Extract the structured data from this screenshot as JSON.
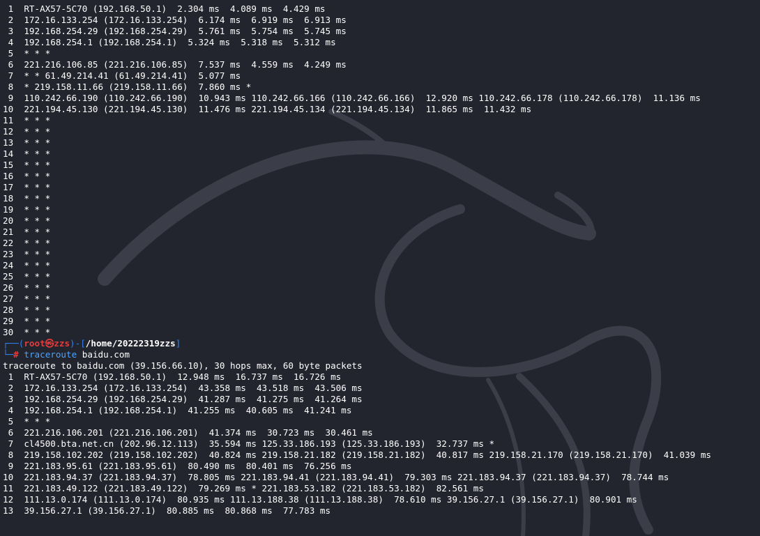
{
  "theme": {
    "background": "#23252e",
    "text": "#ffffff",
    "prompt_frame": "#2f80ed",
    "prompt_user": "#e83a3a",
    "command": "#4aa3ff"
  },
  "icons": {
    "skull_symbol": "㉿"
  },
  "terminal": {
    "lines_before": [
      " 1  RT-AX57-5C70 (192.168.50.1)  2.304 ms  4.089 ms  4.429 ms",
      " 2  172.16.133.254 (172.16.133.254)  6.174 ms  6.919 ms  6.913 ms",
      " 3  192.168.254.29 (192.168.254.29)  5.761 ms  5.754 ms  5.745 ms",
      " 4  192.168.254.1 (192.168.254.1)  5.324 ms  5.318 ms  5.312 ms",
      " 5  * * *",
      " 6  221.216.106.85 (221.216.106.85)  7.537 ms  4.559 ms  4.249 ms",
      " 7  * * 61.49.214.41 (61.49.214.41)  5.077 ms",
      " 8  * 219.158.11.66 (219.158.11.66)  7.860 ms *",
      " 9  110.242.66.190 (110.242.66.190)  10.943 ms 110.242.66.166 (110.242.66.166)  12.920 ms 110.242.66.178 (110.242.66.178)  11.136 ms",
      "10  221.194.45.130 (221.194.45.130)  11.476 ms 221.194.45.134 (221.194.45.134)  11.865 ms  11.432 ms",
      "11  * * *",
      "12  * * *",
      "13  * * *",
      "14  * * *",
      "15  * * *",
      "16  * * *",
      "17  * * *",
      "18  * * *",
      "19  * * *",
      "20  * * *",
      "21  * * *",
      "22  * * *",
      "23  * * *",
      "24  * * *",
      "25  * * *",
      "26  * * *",
      "27  * * *",
      "28  * * *",
      "29  * * *",
      "30  * * *"
    ],
    "prompt": {
      "frame_open": "┌──(",
      "user": "root",
      "at": "㉿",
      "host": "zzs",
      "frame_mid": ")-[",
      "path": "/home/20222319zzs",
      "frame_close": "]",
      "second_frame": "└─",
      "hash": "#",
      "command": "traceroute",
      "argument": "baidu.com"
    },
    "lines_after": [
      "traceroute to baidu.com (39.156.66.10), 30 hops max, 60 byte packets",
      " 1  RT-AX57-5C70 (192.168.50.1)  12.948 ms  16.737 ms  16.726 ms",
      " 2  172.16.133.254 (172.16.133.254)  43.358 ms  43.518 ms  43.506 ms",
      " 3  192.168.254.29 (192.168.254.29)  41.287 ms  41.275 ms  41.264 ms",
      " 4  192.168.254.1 (192.168.254.1)  41.255 ms  40.605 ms  41.241 ms",
      " 5  * * *",
      " 6  221.216.106.201 (221.216.106.201)  41.374 ms  30.723 ms  30.461 ms",
      " 7  cl4500.bta.net.cn (202.96.12.113)  35.594 ms 125.33.186.193 (125.33.186.193)  32.737 ms *",
      " 8  219.158.102.202 (219.158.102.202)  40.824 ms 219.158.21.182 (219.158.21.182)  40.817 ms 219.158.21.170 (219.158.21.170)  41.039 ms",
      " 9  221.183.95.61 (221.183.95.61)  80.490 ms  80.401 ms  76.256 ms",
      "10  221.183.94.37 (221.183.94.37)  78.805 ms 221.183.94.41 (221.183.94.41)  79.303 ms 221.183.94.37 (221.183.94.37)  78.744 ms",
      "11  221.183.49.122 (221.183.49.122)  79.269 ms * 221.183.53.182 (221.183.53.182)  82.561 ms",
      "12  111.13.0.174 (111.13.0.174)  80.935 ms 111.13.188.38 (111.13.188.38)  78.610 ms 39.156.27.1 (39.156.27.1)  80.901 ms",
      "13  39.156.27.1 (39.156.27.1)  80.885 ms  80.868 ms  77.783 ms"
    ]
  }
}
